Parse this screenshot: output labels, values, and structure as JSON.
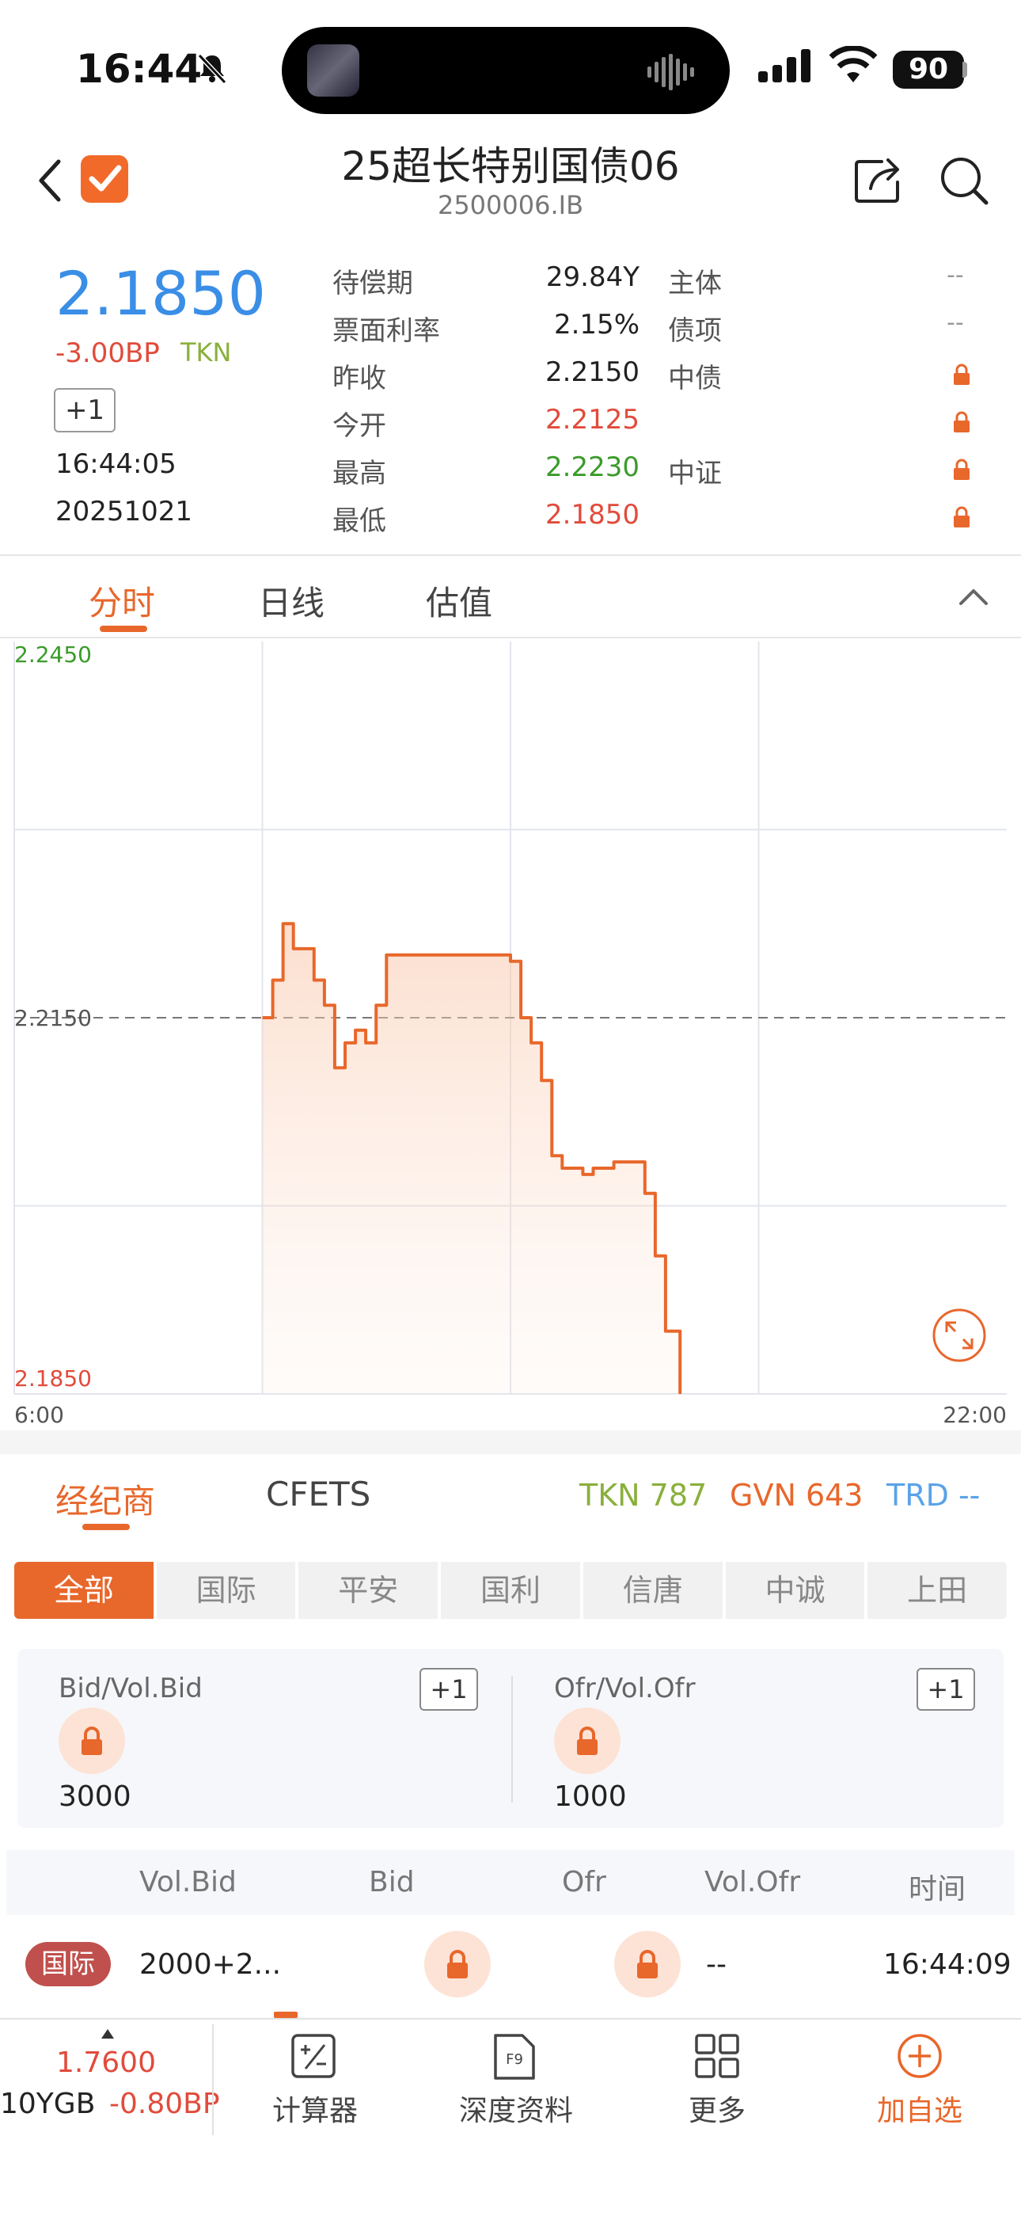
{
  "status_bar": {
    "time": "16:44",
    "battery": "90"
  },
  "header": {
    "title": "25超长特别国债06",
    "code": "2500006.IB"
  },
  "quote": {
    "price": "2.1850",
    "change_bp": "-3.00BP",
    "source": "TKN",
    "plus_label": "+1",
    "time": "16:44:05",
    "date": "20251021",
    "rows": [
      {
        "label": "待偿期",
        "value": "29.84Y",
        "value_color": "#222222",
        "right_label": "主体",
        "right_value": "--"
      },
      {
        "label": "票面利率",
        "value": "2.15%",
        "value_color": "#222222",
        "right_label": "债项",
        "right_value": "--"
      },
      {
        "label": "昨收",
        "value": "2.2150",
        "value_color": "#222222",
        "right_label": "中债",
        "right_value": "lock"
      },
      {
        "label": "今开",
        "value": "2.2125",
        "value_color": "#e14b3b",
        "right_label": "",
        "right_value": "lock"
      },
      {
        "label": "最高",
        "value": "2.2230",
        "value_color": "#3a9b2a",
        "right_label": "中证",
        "right_value": "lock"
      },
      {
        "label": "最低",
        "value": "2.1850",
        "value_color": "#e14b3b",
        "right_label": "",
        "right_value": "lock"
      }
    ]
  },
  "chart_tabs": [
    "分时",
    "日线",
    "估值"
  ],
  "chart_data": {
    "type": "line",
    "series": [
      {
        "x": [
          "10:00",
          "10:10",
          "10:20",
          "10:30",
          "10:40",
          "10:50",
          "11:00",
          "11:10",
          "11:20",
          "11:30",
          "11:40",
          "11:50",
          "12:00",
          "12:10",
          "12:20",
          "12:30",
          "12:40",
          "12:50",
          "13:00",
          "13:10",
          "13:20",
          "13:30",
          "13:40",
          "13:50",
          "14:00",
          "14:10",
          "14:20",
          "14:30",
          "14:40",
          "14:50",
          "15:00",
          "15:10",
          "15:20",
          "15:30",
          "15:40",
          "15:50",
          "16:00",
          "16:10",
          "16:20",
          "16:30",
          "16:44"
        ],
        "values": [
          2.215,
          2.218,
          2.2225,
          2.2205,
          2.2205,
          2.218,
          2.216,
          2.211,
          2.213,
          2.214,
          2.213,
          2.216,
          2.22,
          2.22,
          2.22,
          2.22,
          2.22,
          2.22,
          2.22,
          2.22,
          2.22,
          2.22,
          2.22,
          2.22,
          2.2195,
          2.215,
          2.213,
          2.21,
          2.204,
          2.203,
          2.203,
          2.2025,
          2.203,
          2.203,
          2.2035,
          2.2035,
          2.2035,
          2.201,
          2.196,
          2.19,
          2.185
        ]
      }
    ],
    "reference_line": 2.215,
    "ylim": [
      2.185,
      2.245
    ],
    "y_ticks": [
      "2.2450",
      "2.2150",
      "2.1850"
    ],
    "x_ticks": [
      "6:00",
      "22:00"
    ],
    "x_range_hours": [
      6,
      22
    ],
    "line_color": "#e8672b",
    "grid": true
  },
  "broker": {
    "tabs": [
      "经纪商",
      "CFETS"
    ],
    "tkn": "TKN 787",
    "gvn": "GVN 643",
    "trd": "TRD --",
    "filters": [
      "全部",
      "国际",
      "平安",
      "国利",
      "信唐",
      "中诚",
      "上田"
    ],
    "bid_label": "Bid/Vol.Bid",
    "ofr_label": "Ofr/Vol.Ofr",
    "plus_label": "+1",
    "bid_vol": "3000",
    "ofr_vol": "1000",
    "table_headers": [
      "Vol.Bid",
      "Bid",
      "Ofr",
      "Vol.Ofr",
      "时间"
    ],
    "row": {
      "broker": "国际",
      "vol_bid": "2000+2...",
      "vol_ofr": "--",
      "time": "16:44:09"
    }
  },
  "bottom_nav": {
    "price": "1.7600",
    "index_name": "10YGB",
    "index_change": "-0.80BP",
    "items": [
      "计算器",
      "深度资料",
      "更多",
      "加自选"
    ]
  },
  "colors": {
    "accent": "#e8672b",
    "up": "#e14b3b",
    "down": "#3a9b2a",
    "price_blue": "#3a8ee6"
  }
}
